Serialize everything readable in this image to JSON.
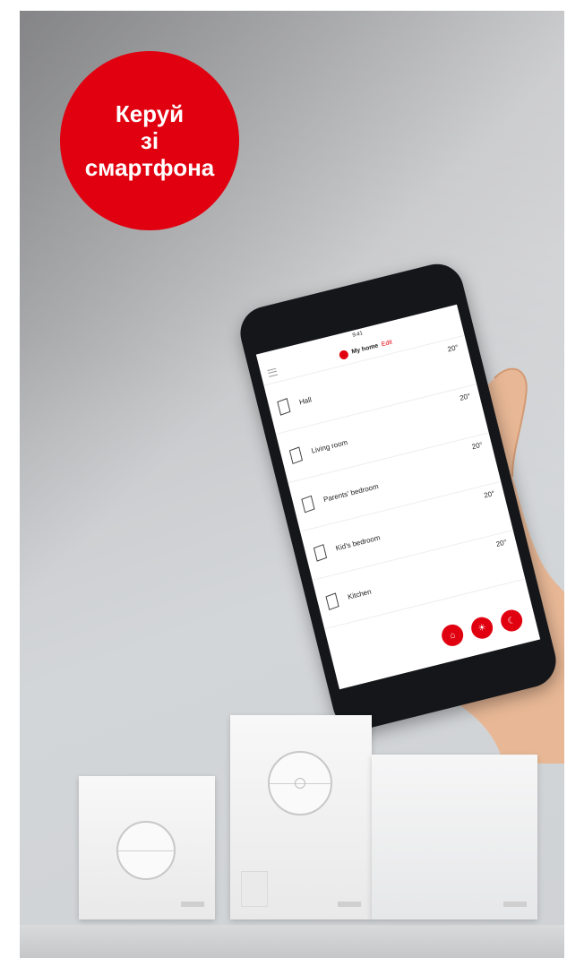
{
  "badge": {
    "line1": "Керуй",
    "line2": "зі",
    "line3": "смартфона",
    "color": "#e1000f"
  },
  "phone_app": {
    "status_time": "9:41",
    "app_name": "My home",
    "app_sub": "Edit",
    "rooms": [
      {
        "name": "Hall",
        "temp": "20°"
      },
      {
        "name": "Living room",
        "temp": "20°"
      },
      {
        "name": "Parents' bedroom",
        "temp": "20°"
      },
      {
        "name": "Kid's bedroom",
        "temp": "20°"
      },
      {
        "name": "Kitchen",
        "temp": "20°"
      }
    ],
    "actions": [
      "home-mode-icon",
      "sun-icon",
      "moon-icon"
    ],
    "accent": "#e1000f"
  },
  "devices": [
    "wall-remote",
    "room-controller",
    "gateway-box"
  ]
}
